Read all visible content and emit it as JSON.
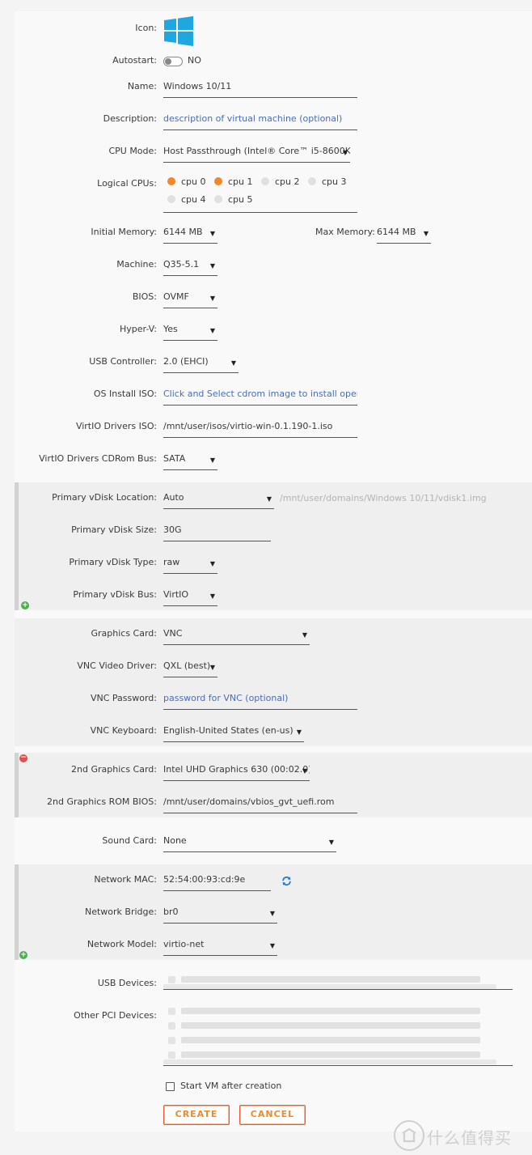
{
  "form": {
    "icon_label": "Icon:",
    "autostart_label": "Autostart:",
    "autostart_value": "NO",
    "name_label": "Name:",
    "name_value": "Windows 10/11",
    "description_label": "Description:",
    "description_placeholder": "description of virtual machine (optional)",
    "cpu_mode_label": "CPU Mode:",
    "cpu_mode_value": "Host Passthrough (Intel® Core™ i5-8600K)",
    "logical_cpus_label": "Logical CPUs:",
    "cpus": [
      {
        "label": "cpu 0",
        "selected": true
      },
      {
        "label": "cpu 1",
        "selected": true
      },
      {
        "label": "cpu 2",
        "selected": false
      },
      {
        "label": "cpu 3",
        "selected": false
      },
      {
        "label": "cpu 4",
        "selected": false
      },
      {
        "label": "cpu 5",
        "selected": false
      }
    ],
    "initial_memory_label": "Initial Memory:",
    "initial_memory_value": "6144 MB",
    "max_memory_label": "Max Memory:",
    "max_memory_value": "6144 MB",
    "machine_label": "Machine:",
    "machine_value": "Q35-5.1",
    "bios_label": "BIOS:",
    "bios_value": "OVMF",
    "hyperv_label": "Hyper-V:",
    "hyperv_value": "Yes",
    "usb_controller_label": "USB Controller:",
    "usb_controller_value": "2.0 (EHCI)",
    "os_iso_label": "OS Install ISO:",
    "os_iso_placeholder": "Click and Select cdrom image to install operati",
    "virtio_iso_label": "VirtIO Drivers ISO:",
    "virtio_iso_value": "/mnt/user/isos/virtio-win-0.1.190-1.iso",
    "virtio_bus_label": "VirtIO Drivers CDRom Bus:",
    "virtio_bus_value": "SATA"
  },
  "vdisk": {
    "location_label": "Primary vDisk Location:",
    "location_value": "Auto",
    "location_path": "/mnt/user/domains/Windows 10/11/vdisk1.img",
    "size_label": "Primary vDisk Size:",
    "size_value": "30G",
    "type_label": "Primary vDisk Type:",
    "type_value": "raw",
    "bus_label": "Primary vDisk Bus:",
    "bus_value": "VirtIO"
  },
  "graphics": {
    "card_label": "Graphics Card:",
    "card_value": "VNC",
    "driver_label": "VNC Video Driver:",
    "driver_value": "QXL (best)",
    "password_label": "VNC Password:",
    "password_placeholder": "password for VNC (optional)",
    "keyboard_label": "VNC Keyboard:",
    "keyboard_value": "English-United States (en-us)"
  },
  "graphics2": {
    "card_label": "2nd Graphics Card:",
    "card_value": "Intel UHD Graphics 630 (00:02.0)",
    "rom_label": "2nd Graphics ROM BIOS:",
    "rom_value": "/mnt/user/domains/vbios_gvt_uefi.rom"
  },
  "sound": {
    "label": "Sound Card:",
    "value": "None"
  },
  "network": {
    "mac_label": "Network MAC:",
    "mac_value": "52:54:00:93:cd:9e",
    "bridge_label": "Network Bridge:",
    "bridge_value": "br0",
    "model_label": "Network Model:",
    "model_value": "virtio-net"
  },
  "devices": {
    "usb_label": "USB Devices:",
    "pci_label": "Other PCI Devices:"
  },
  "start_after_label": "Start VM after creation",
  "buttons": {
    "create": "CREATE",
    "cancel": "CANCEL"
  },
  "colors": {
    "accent_orange": "#f0882a",
    "button_border": "#e35b36",
    "link_blue": "#486dba",
    "windows_blue": "#1ea7e1"
  },
  "watermark_text": "什么值得买"
}
